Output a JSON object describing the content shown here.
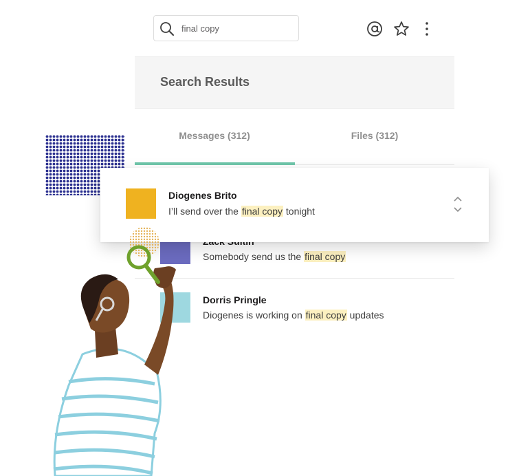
{
  "search": {
    "value": "final copy",
    "placeholder": ""
  },
  "header": {
    "title": "Search Results"
  },
  "tabs": [
    {
      "label": "Messages (312)",
      "active": true
    },
    {
      "label": "Files (312)",
      "active": false
    }
  ],
  "results": [
    {
      "name": "Diogenes Brito",
      "pre": "I’ll send over the ",
      "highlight": "final copy",
      "post": " tonight",
      "avatar_color": "#efb220"
    },
    {
      "name": "Zack Sultin",
      "pre": "Somebody send us the ",
      "highlight": "final copy",
      "post": "",
      "avatar_color": "#6b6bbf"
    },
    {
      "name": "Dorris Pringle",
      "pre": "Diogenes is working on ",
      "highlight": "final copy",
      "post": " updates",
      "avatar_color": "#9ed8e0"
    }
  ],
  "colors": {
    "accent": "#6fc6aa",
    "highlight": "#fcf0c0"
  },
  "icons": [
    "search-icon",
    "at-mention-icon",
    "star-icon",
    "more-vertical-icon",
    "chevron-up-down-icon"
  ]
}
